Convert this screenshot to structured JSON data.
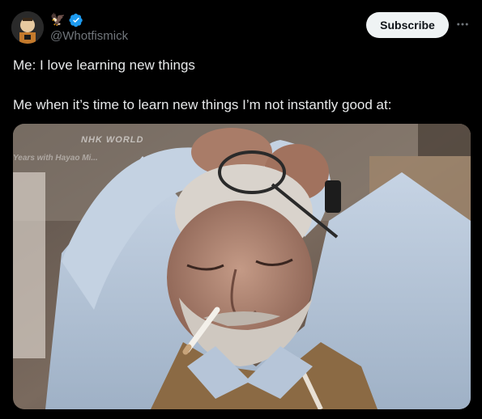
{
  "post": {
    "display_name": "🦅",
    "handle": "@Whotfismick",
    "verified": true,
    "subscribe_label": "Subscribe",
    "more_label": "⋯",
    "text_lines": [
      "Me: I love learning new things",
      "Me when it’s time to learn new things I’m not instantly good at:"
    ]
  },
  "media": {
    "description_icon": "photo",
    "watermark_channel": "NHK WORLD",
    "watermark_subtitle": "Years with Hayao Mi..."
  },
  "colors": {
    "background": "#000000",
    "text_primary": "#e7e9ea",
    "text_secondary": "#71767b",
    "verified_blue": "#1d9bf0",
    "subscribe_bg": "#eff3f4",
    "subscribe_text": "#0f1419"
  }
}
